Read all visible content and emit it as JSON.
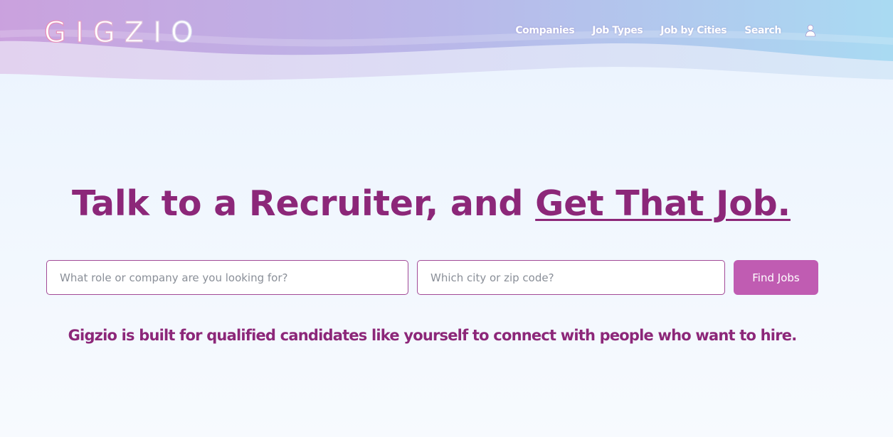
{
  "brand": {
    "logo_text": "GIGZIO"
  },
  "nav": {
    "items": [
      {
        "label": "Companies"
      },
      {
        "label": "Job Types"
      },
      {
        "label": "Job by Cities"
      },
      {
        "label": "Search"
      }
    ],
    "account_icon": "user-icon"
  },
  "hero": {
    "headline_lead": "Talk to a Recruiter, and ",
    "headline_emphasis": "Get That Job."
  },
  "search": {
    "role_placeholder": "What role or company are you looking for?",
    "role_value": "",
    "city_placeholder": "Which city or zip code?",
    "city_value": "",
    "button_label": "Find Jobs"
  },
  "tagline": "Gigzio is built for qualified candidates like yourself to connect with people who want to hire.",
  "colors": {
    "brand_purple": "#8c2779",
    "button": "#c05cb2",
    "input_border": "#a24a97",
    "header_gradient_start": "#c79fdc",
    "header_gradient_end": "#a7d8f1"
  }
}
